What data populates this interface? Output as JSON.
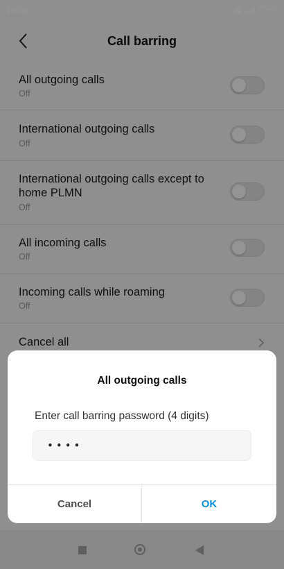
{
  "status_bar": {
    "time": "10:00",
    "battery": "100"
  },
  "header": {
    "title": "Call barring"
  },
  "settings": [
    {
      "label": "All outgoing calls",
      "sub": "Off"
    },
    {
      "label": "International outgoing calls",
      "sub": "Off"
    },
    {
      "label": "International outgoing calls except to home PLMN",
      "sub": "Off"
    },
    {
      "label": "All incoming calls",
      "sub": "Off"
    },
    {
      "label": "Incoming calls while roaming",
      "sub": "Off"
    },
    {
      "label": "Cancel all"
    }
  ],
  "dialog": {
    "title": "All outgoing calls",
    "prompt": "Enter call barring password (4 digits)",
    "password_value": "••••",
    "cancel_label": "Cancel",
    "ok_label": "OK"
  },
  "colors": {
    "accent": "#0a8fe0",
    "scrim": "#000000"
  }
}
